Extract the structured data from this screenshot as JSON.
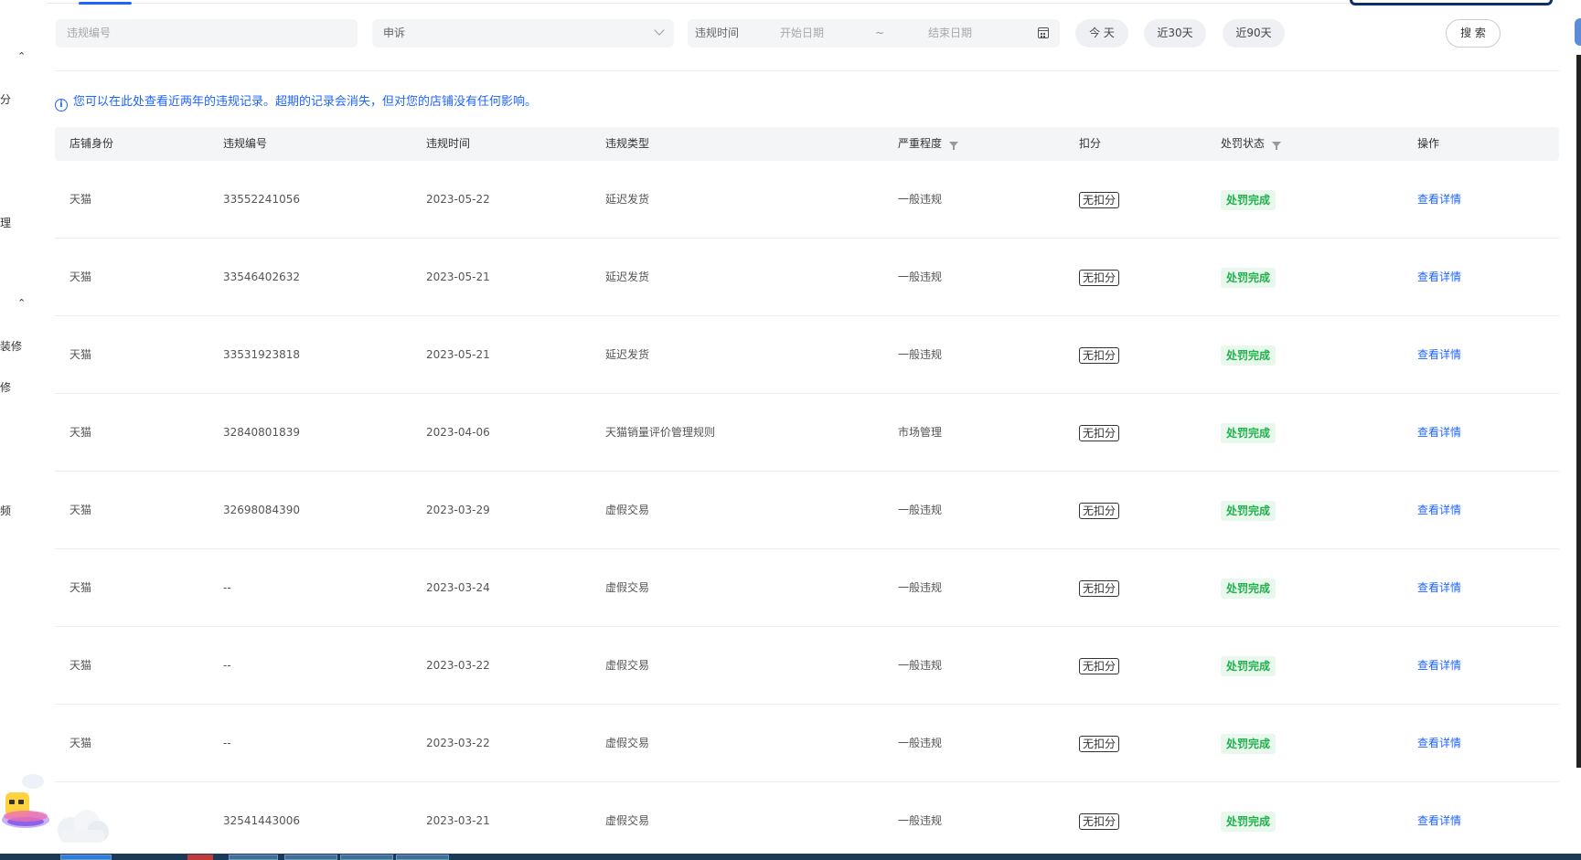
{
  "sidebar": {
    "items": [
      "分",
      "理",
      "装修",
      "修",
      "频"
    ]
  },
  "filters": {
    "violation_no_placeholder": "违规编号",
    "appeal_select_value": "申诉",
    "date_label": "违规时间",
    "start_placeholder": "开始日期",
    "range_separator": "~",
    "end_placeholder": "结束日期",
    "quick_today": "今 天",
    "quick_30": "近30天",
    "quick_90": "近90天",
    "search_label": "搜 索"
  },
  "notice": "您可以在此处查看近两年的违规记录。超期的记录会消失，但对您的店铺没有任何影响。",
  "table": {
    "headers": {
      "shop": "店铺身份",
      "no": "违规编号",
      "time": "违规时间",
      "type": "违规类型",
      "severity": "严重程度",
      "points": "扣分",
      "status": "处罚状态",
      "action": "操作"
    },
    "rows": [
      {
        "shop": "天猫",
        "no": "33552241056",
        "time": "2023-05-22",
        "type": "延迟发货",
        "severity": "一般违规",
        "points": "无扣分",
        "status": "处罚完成",
        "action": "查看详情"
      },
      {
        "shop": "天猫",
        "no": "33546402632",
        "time": "2023-05-21",
        "type": "延迟发货",
        "severity": "一般违规",
        "points": "无扣分",
        "status": "处罚完成",
        "action": "查看详情"
      },
      {
        "shop": "天猫",
        "no": "33531923818",
        "time": "2023-05-21",
        "type": "延迟发货",
        "severity": "一般违规",
        "points": "无扣分",
        "status": "处罚完成",
        "action": "查看详情"
      },
      {
        "shop": "天猫",
        "no": "32840801839",
        "time": "2023-04-06",
        "type": "天猫销量评价管理规则",
        "severity": "市场管理",
        "points": "无扣分",
        "status": "处罚完成",
        "action": "查看详情"
      },
      {
        "shop": "天猫",
        "no": "32698084390",
        "time": "2023-03-29",
        "type": "虚假交易",
        "severity": "一般违规",
        "points": "无扣分",
        "status": "处罚完成",
        "action": "查看详情"
      },
      {
        "shop": "天猫",
        "no": "--",
        "time": "2023-03-24",
        "type": "虚假交易",
        "severity": "一般违规",
        "points": "无扣分",
        "status": "处罚完成",
        "action": "查看详情"
      },
      {
        "shop": "天猫",
        "no": "--",
        "time": "2023-03-22",
        "type": "虚假交易",
        "severity": "一般违规",
        "points": "无扣分",
        "status": "处罚完成",
        "action": "查看详情"
      },
      {
        "shop": "天猫",
        "no": "--",
        "time": "2023-03-22",
        "type": "虚假交易",
        "severity": "一般违规",
        "points": "无扣分",
        "status": "处罚完成",
        "action": "查看详情"
      },
      {
        "shop": "",
        "no": "32541443006",
        "time": "2023-03-21",
        "type": "虚假交易",
        "severity": "一般违规",
        "points": "无扣分",
        "status": "处罚完成",
        "action": "查看详情"
      }
    ]
  },
  "colors": {
    "accent": "#1f64ff",
    "success": "#22b14c",
    "success_bg": "#e8f8ec"
  }
}
